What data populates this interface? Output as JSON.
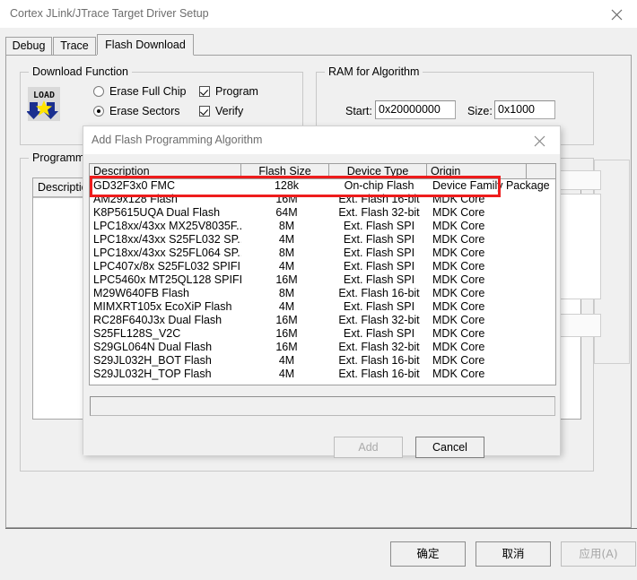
{
  "window": {
    "title": "Cortex JLink/JTrace Target Driver Setup",
    "close_icon": "close-icon"
  },
  "tabs": [
    {
      "label": "Debug",
      "active": false
    },
    {
      "label": "Trace",
      "active": false
    },
    {
      "label": "Flash Download",
      "active": true
    }
  ],
  "download_function": {
    "group_label": "Download Function",
    "icon": "load-icon",
    "icon_text": "LOAD",
    "erase_full_chip": {
      "label": "Erase Full Chip",
      "selected": false
    },
    "erase_sectors": {
      "label": "Erase Sectors",
      "selected": true
    },
    "program": {
      "label": "Program",
      "checked": true
    },
    "verify": {
      "label": "Verify",
      "checked": true
    }
  },
  "ram_for_algorithm": {
    "group_label": "RAM for Algorithm",
    "start_label": "Start:",
    "start_value": "0x20000000",
    "size_label": "Size:",
    "size_value": "0x1000"
  },
  "programming_algorithm": {
    "group_label": "Programming Algorithm",
    "column_header": "Description"
  },
  "dialog": {
    "title": "Add Flash Programming Algorithm",
    "close_icon": "close-icon",
    "columns": [
      "Description",
      "Flash Size",
      "Device Type",
      "Origin"
    ],
    "rows": [
      {
        "description": "GD32F3x0 FMC",
        "flash_size": "128k",
        "device_type": "On-chip Flash",
        "origin": "Device Family Package",
        "highlighted": true
      },
      {
        "description": "AM29x128 Flash",
        "flash_size": "16M",
        "device_type": "Ext. Flash 16-bit",
        "origin": "MDK Core",
        "highlighted": false
      },
      {
        "description": "K8P5615UQA Dual Flash",
        "flash_size": "64M",
        "device_type": "Ext. Flash 32-bit",
        "origin": "MDK Core",
        "highlighted": false
      },
      {
        "description": "LPC18xx/43xx MX25V8035F...",
        "flash_size": "8M",
        "device_type": "Ext. Flash SPI",
        "origin": "MDK Core",
        "highlighted": false
      },
      {
        "description": "LPC18xx/43xx S25FL032 SP...",
        "flash_size": "4M",
        "device_type": "Ext. Flash SPI",
        "origin": "MDK Core",
        "highlighted": false
      },
      {
        "description": "LPC18xx/43xx S25FL064 SP...",
        "flash_size": "8M",
        "device_type": "Ext. Flash SPI",
        "origin": "MDK Core",
        "highlighted": false
      },
      {
        "description": "LPC407x/8x S25FL032 SPIFI",
        "flash_size": "4M",
        "device_type": "Ext. Flash SPI",
        "origin": "MDK Core",
        "highlighted": false
      },
      {
        "description": "LPC5460x MT25QL128 SPIFI",
        "flash_size": "16M",
        "device_type": "Ext. Flash SPI",
        "origin": "MDK Core",
        "highlighted": false
      },
      {
        "description": "M29W640FB Flash",
        "flash_size": "8M",
        "device_type": "Ext. Flash 16-bit",
        "origin": "MDK Core",
        "highlighted": false
      },
      {
        "description": "MIMXRT105x EcoXiP Flash",
        "flash_size": "4M",
        "device_type": "Ext. Flash SPI",
        "origin": "MDK Core",
        "highlighted": false
      },
      {
        "description": "RC28F640J3x Dual Flash",
        "flash_size": "16M",
        "device_type": "Ext. Flash 32-bit",
        "origin": "MDK Core",
        "highlighted": false
      },
      {
        "description": "S25FL128S_V2C",
        "flash_size": "16M",
        "device_type": "Ext. Flash SPI",
        "origin": "MDK Core",
        "highlighted": false
      },
      {
        "description": "S29GL064N Dual Flash",
        "flash_size": "16M",
        "device_type": "Ext. Flash 32-bit",
        "origin": "MDK Core",
        "highlighted": false
      },
      {
        "description": "S29JL032H_BOT Flash",
        "flash_size": "4M",
        "device_type": "Ext. Flash 16-bit",
        "origin": "MDK Core",
        "highlighted": false
      },
      {
        "description": "S29JL032H_TOP Flash",
        "flash_size": "4M",
        "device_type": "Ext. Flash 16-bit",
        "origin": "MDK Core",
        "highlighted": false
      }
    ],
    "path_value": "",
    "add_label": "Add",
    "add_enabled": false,
    "cancel_label": "Cancel",
    "cancel_enabled": true
  },
  "footer": {
    "ok_label": "确定",
    "cancel_label": "取消",
    "apply_label": "应用(A)",
    "apply_enabled": false
  },
  "colors": {
    "annotation_red": "#ee1c1c",
    "window_bg": "#f0f0f0",
    "titlebar_bg": "#ffffff",
    "list_bg": "#ffffff",
    "disabled_text": "#aaaaaa"
  }
}
